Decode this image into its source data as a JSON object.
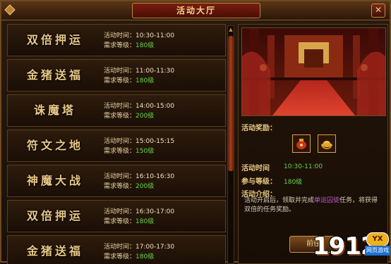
{
  "window": {
    "title": "活动大厅",
    "close_glyph": "✕"
  },
  "labels": {
    "time": "活动时间：",
    "level": "需求等级："
  },
  "activities": [
    {
      "name": "双倍押运",
      "time": "10:30-11:00",
      "level": "180级"
    },
    {
      "name": "金猪送福",
      "time": "11:00-11:30",
      "level": "180级"
    },
    {
      "name": "诛魔塔",
      "time": "14:00-15:00",
      "level": "200级"
    },
    {
      "name": "符文之地",
      "time": "15:00-15:15",
      "level": "150级"
    },
    {
      "name": "神魔大战",
      "time": "16:10-16:30",
      "level": "200级"
    },
    {
      "name": "双倍押运",
      "time": "16:30-17:00",
      "level": "180级"
    },
    {
      "name": "金猪送福",
      "time": "17:00-17:30",
      "level": "180级"
    }
  ],
  "detail": {
    "reward_label": "活动奖励：",
    "time_label": "活动时间",
    "time_value": "10:30-11:00",
    "level_label": "参与等级：",
    "level_value": "180级",
    "intro_label": "活动介绍：",
    "intro_text_a": "活动开启后，领取并完成",
    "intro_quest": "单运囚徒",
    "intro_text_b": "任务，将获得双倍的任务奖励。",
    "go_label": "前往"
  },
  "logo": {
    "number": "1912",
    "badge": "YX",
    "sub": "网页游戏"
  },
  "colors": {
    "accent_gold": "#e9c886",
    "level_green": "#66d64a",
    "quest_purple": "#c45ad4"
  }
}
